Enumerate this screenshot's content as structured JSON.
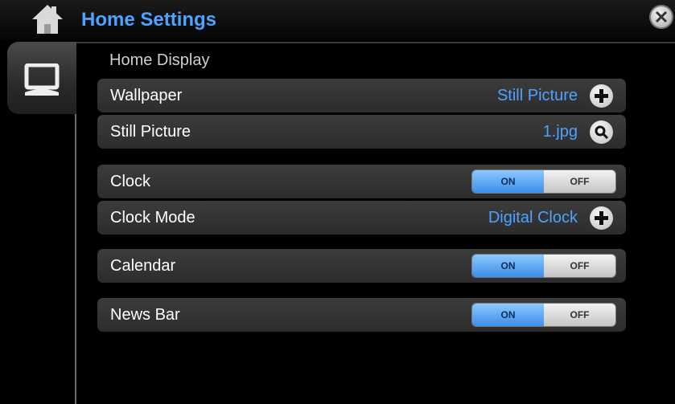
{
  "header": {
    "title": "Home Settings"
  },
  "section": {
    "title": "Home Display"
  },
  "rows": {
    "wallpaper": {
      "label": "Wallpaper",
      "value": "Still Picture"
    },
    "still_picture": {
      "label": "Still Picture",
      "value": "1.jpg"
    },
    "clock": {
      "label": "Clock",
      "on": "ON",
      "off": "OFF",
      "state": "on"
    },
    "clock_mode": {
      "label": "Clock Mode",
      "value": "Digital Clock"
    },
    "calendar": {
      "label": "Calendar",
      "on": "ON",
      "off": "OFF",
      "state": "on"
    },
    "news_bar": {
      "label": "News Bar",
      "on": "ON",
      "off": "OFF",
      "state": "on"
    }
  },
  "colors": {
    "accent": "#4da3ff",
    "toggle_on": "#3b8fe8"
  },
  "icons": [
    "home-icon",
    "close-icon",
    "display-icon",
    "plus-icon",
    "search-icon"
  ]
}
